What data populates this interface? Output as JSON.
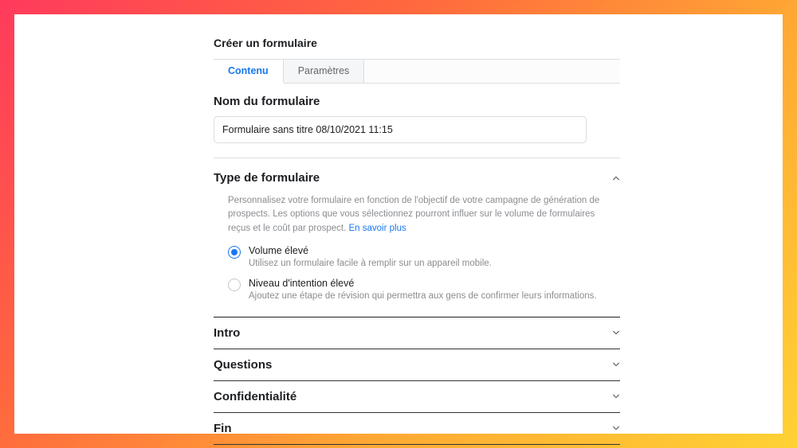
{
  "pageTitle": "Créer un formulaire",
  "tabs": {
    "content": "Contenu",
    "settings": "Paramètres"
  },
  "formName": {
    "label": "Nom du formulaire",
    "value": "Formulaire sans titre 08/10/2021 11:15"
  },
  "formType": {
    "label": "Type de formulaire",
    "description": "Personnalisez votre formulaire en fonction de l'objectif de votre campagne de génération de prospects. Les options que vous sélectionnez pourront influer sur le volume de formulaires reçus et le coût par prospect. ",
    "learnMore": "En savoir plus",
    "options": {
      "high_volume": {
        "title": "Volume élevé",
        "sub": "Utilisez un formulaire facile à remplir sur un appareil mobile."
      },
      "high_intent": {
        "title": "Niveau d'intention élevé",
        "sub": "Ajoutez une étape de révision qui permettra aux gens de confirmer leurs informations."
      }
    }
  },
  "sections": {
    "intro": "Intro",
    "questions": "Questions",
    "privacy": "Confidentialité",
    "end": "Fin"
  }
}
